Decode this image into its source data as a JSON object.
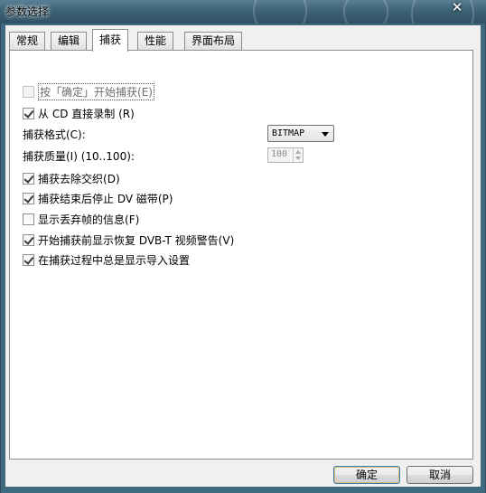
{
  "window": {
    "title": "参数选择",
    "close_glyph": "✕"
  },
  "tabs": [
    {
      "label": "常规"
    },
    {
      "label": "编辑"
    },
    {
      "label": "捕获"
    },
    {
      "label": "性能"
    },
    {
      "label": "界面布局"
    }
  ],
  "active_tab": "捕获",
  "options": {
    "press_ok": {
      "label": "按「确定」开始捕获",
      "hotkey": "(E)",
      "checked": false,
      "disabled": true
    },
    "direct_cd": {
      "label": "从 CD 直接录制",
      "hotkey": "(R)",
      "checked": true
    },
    "format": {
      "label": "捕获格式(C):",
      "value": "BITMAP"
    },
    "quality": {
      "label": "捕获质量(I) (10..100):",
      "value": "100"
    },
    "deinterlace": {
      "label": "捕获去除交织",
      "hotkey": "(D)",
      "checked": true
    },
    "stop_dv": {
      "label": "捕获结束后停止 DV 磁带",
      "hotkey": "(P)",
      "checked": true
    },
    "show_dropped": {
      "label": "显示丢弃帧的信息",
      "hotkey": "(F)",
      "checked": false
    },
    "dvbt_warning": {
      "label": "开始捕获前显示恢复 DVB-T 视频警告",
      "hotkey": "(V)",
      "checked": true
    },
    "import_settings": {
      "label": "在捕获过程中总是显示导入设置",
      "checked": true
    }
  },
  "buttons": {
    "ok": "确定",
    "cancel": "取消"
  }
}
